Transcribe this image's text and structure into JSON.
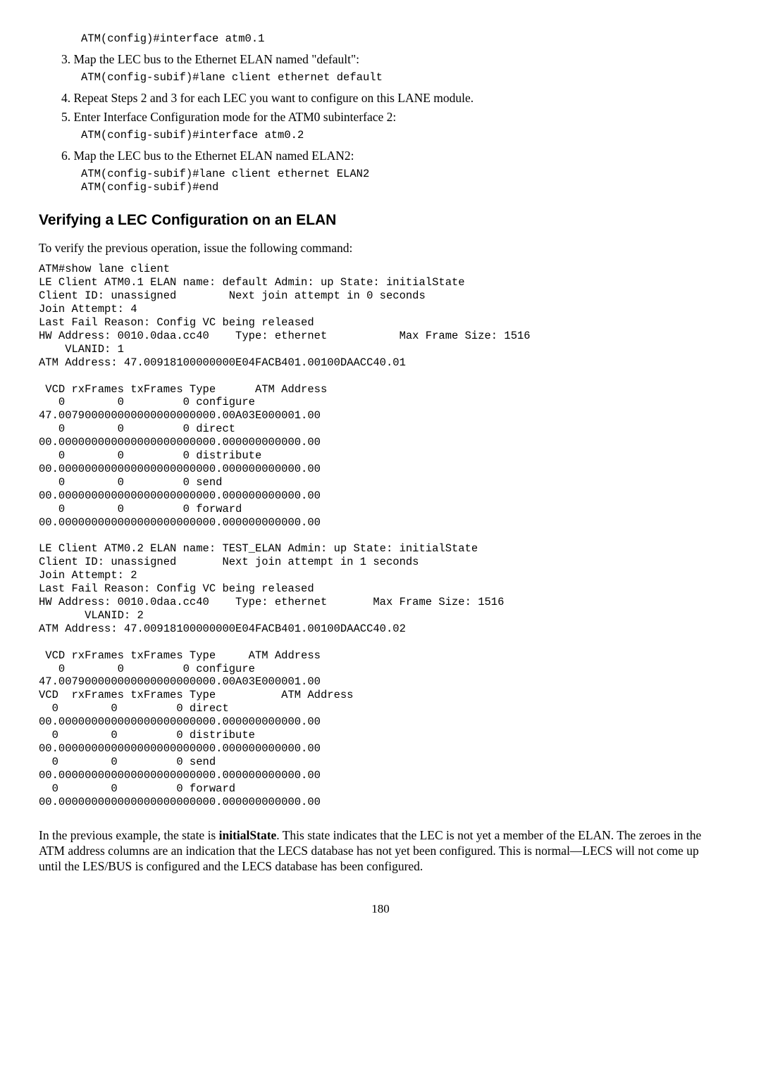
{
  "steps": {
    "s2_code": "ATM(config)#interface atm0.1",
    "s3_text": "Map the LEC bus to the Ethernet ELAN named \"default\":",
    "s3_code": "ATM(config-subif)#lane client ethernet default",
    "s4_text": "Repeat Steps 2 and 3 for each LEC you want to configure on this LANE module.",
    "s5_text": "Enter Interface Configuration mode for the ATM0 subinterface 2:",
    "s5_code": "ATM(config-subif)#interface atm0.2",
    "s6_text": "Map the LEC bus to the Ethernet ELAN named ELAN2:",
    "s6_code": "ATM(config-subif)#lane client ethernet ELAN2\nATM(config-subif)#end"
  },
  "heading": "Verifying a LEC Configuration on an ELAN",
  "intro": "To verify the previous operation, issue the following command:",
  "cli_output": "ATM#show lane client\nLE Client ATM0.1 ELAN name: default Admin: up State: initialState\nClient ID: unassigned        Next join attempt in 0 seconds\nJoin Attempt: 4\nLast Fail Reason: Config VC being released\nHW Address: 0010.0daa.cc40    Type: ethernet           Max Frame Size: 1516\n    VLANID: 1\nATM Address: 47.00918100000000E04FACB401.00100DAACC40.01\n\n VCD rxFrames txFrames Type      ATM Address\n   0        0         0 configure\n47.007900000000000000000000.00A03E000001.00\n   0        0         0 direct\n00.000000000000000000000000.000000000000.00\n   0        0         0 distribute\n00.000000000000000000000000.000000000000.00\n   0        0         0 send\n00.000000000000000000000000.000000000000.00\n   0        0         0 forward\n00.000000000000000000000000.000000000000.00\n\nLE Client ATM0.2 ELAN name: TEST_ELAN Admin: up State: initialState\nClient ID: unassigned       Next join attempt in 1 seconds\nJoin Attempt: 2\nLast Fail Reason: Config VC being released\nHW Address: 0010.0daa.cc40    Type: ethernet       Max Frame Size: 1516\n       VLANID: 2\nATM Address: 47.00918100000000E04FACB401.00100DAACC40.02\n\n VCD rxFrames txFrames Type     ATM Address\n   0        0         0 configure\n47.007900000000000000000000.00A03E000001.00\nVCD  rxFrames txFrames Type          ATM Address\n  0        0         0 direct\n00.000000000000000000000000.000000000000.00\n  0        0         0 distribute\n00.000000000000000000000000.000000000000.00\n  0        0         0 send\n00.000000000000000000000000.000000000000.00\n  0        0         0 forward\n00.000000000000000000000000.000000000000.00",
  "conclusion_pre": "In the previous example, the state is ",
  "conclusion_bold": "initialState",
  "conclusion_post": ". This state indicates that the LEC is not yet a member of the ELAN. The zeroes in the ATM address columns are an indication that the LECS database has not yet been configured. This is normal—LECS will not come up until the LES/BUS is configured and the LECS database has been configured.",
  "page_number": "180"
}
